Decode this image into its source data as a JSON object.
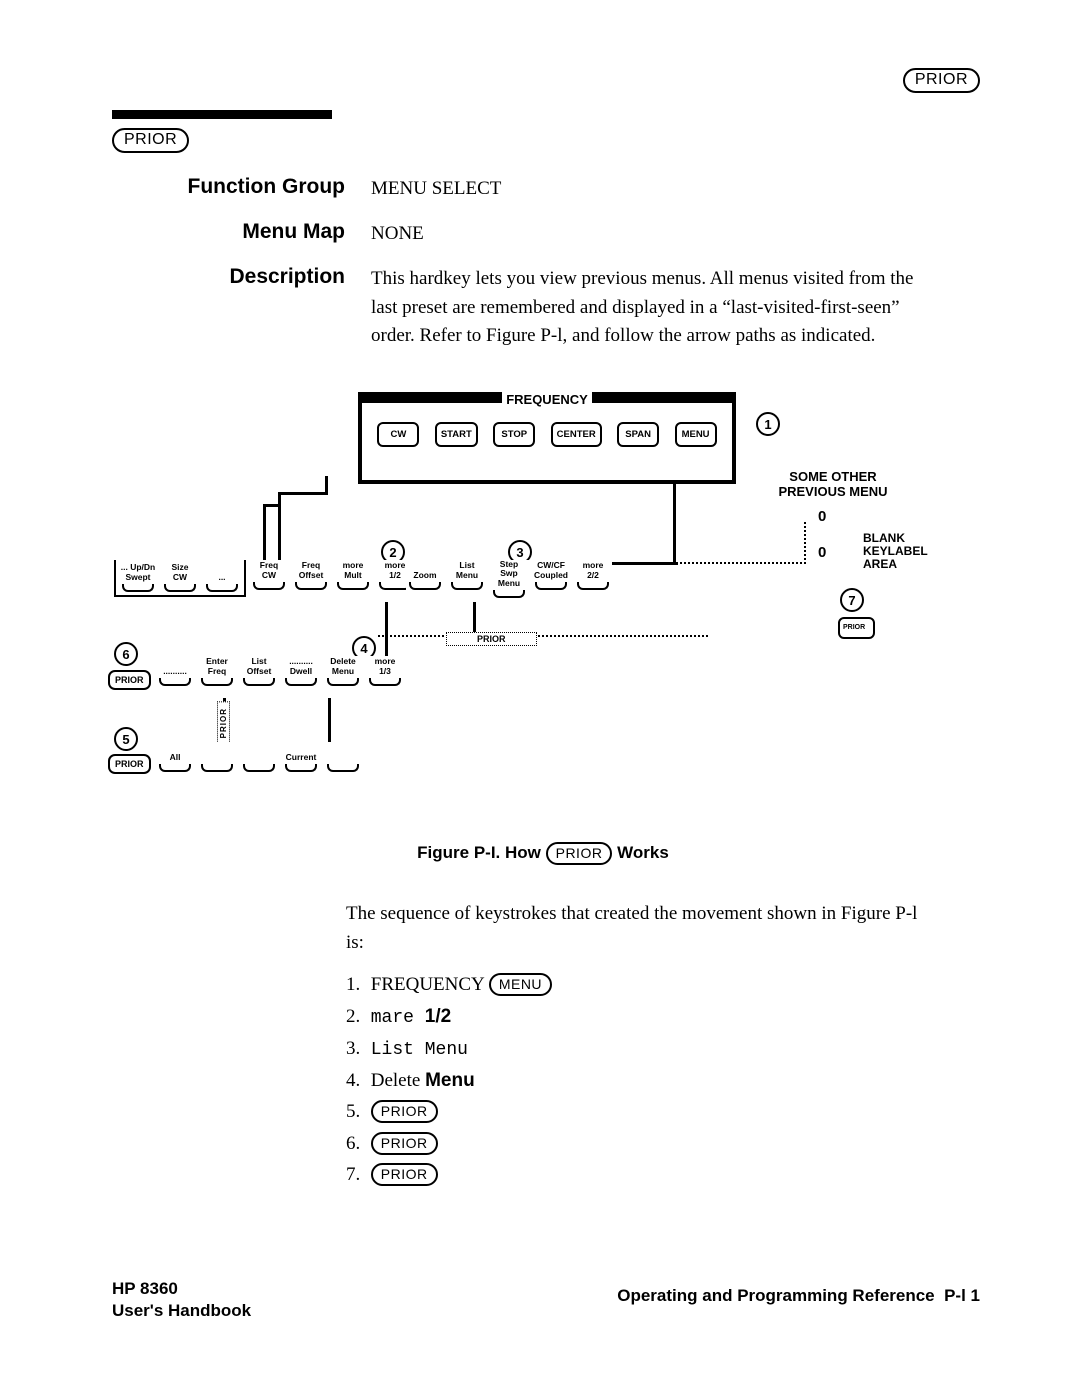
{
  "keycaps": {
    "prior": "PRIOR",
    "menu": "MENU"
  },
  "rows": {
    "function_group": {
      "label": "Function Group",
      "value": "MENU  SELECT"
    },
    "menu_map": {
      "label": "Menu Map",
      "value": "NONE"
    },
    "description": {
      "label": "Description",
      "value": "This hardkey lets you view previous menus. All menus visited from the last preset are remembered and displayed in a “last-visited-first-seen” order. Refer to Figure P-l, and follow the arrow paths as indicated."
    }
  },
  "figure": {
    "freq_title": "FREQUENCY",
    "freq_keys": [
      "CW",
      "START",
      "STOP",
      "CENTER",
      "SPAN",
      "MENU"
    ],
    "some_other": "SOME OTHER\nPREVIOUS MENU",
    "blank": "BLANK\nKEYLABEL\nAREA",
    "zero": "0",
    "row_a_group": [
      "... Up/Dn\nSwept",
      "Size\nCW",
      "..."
    ],
    "row_a_rest": [
      "Freq\nCW",
      "Freq\nOffset",
      "more\nMult",
      "more\n1/2"
    ],
    "row_b": [
      "Zoom",
      "List\nMenu",
      "Step Swp\nMenu",
      "CW/CF\nCoupled",
      "more\n2/2"
    ],
    "row_c": [
      "..........",
      "Enter\nFreq",
      "List\nOffset",
      "..........\nDwell",
      "Delete\nMenu",
      "more\n1/3"
    ],
    "row_d": [
      "All",
      "",
      "",
      "Current",
      ""
    ],
    "prior_label": "PRIOR",
    "caption_a": "Figure P-I. How ",
    "caption_b": " Works"
  },
  "body": {
    "intro": "The sequence of keystrokes that created the movement shown in Figure P-l is:",
    "steps": [
      {
        "n": "1.",
        "text": " FREQUENCY ",
        "key": "MENU"
      },
      {
        "n": "2.",
        "mono": "mare ",
        "bold12": "1/2"
      },
      {
        "n": "3.",
        "mono": "List Menu"
      },
      {
        "n": "4.",
        "text": " Delete ",
        "sansbold": "Menu"
      },
      {
        "n": "5.",
        "key": "PRIOR"
      },
      {
        "n": "6.",
        "key": "PRIOR"
      },
      {
        "n": "7.",
        "key": "PRIOR"
      }
    ]
  },
  "footer": {
    "left_a": "HP 8360",
    "left_b": "User's Handbook",
    "right_a": "Operating and Programming Reference",
    "right_b": "P-l 1"
  }
}
